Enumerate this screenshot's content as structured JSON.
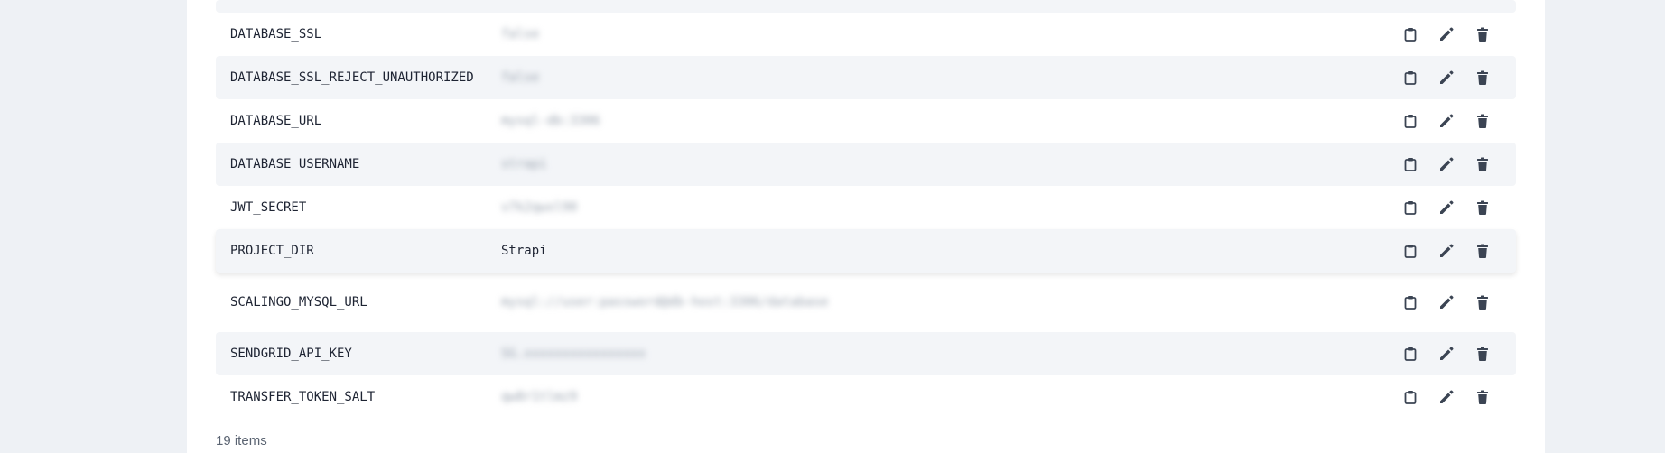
{
  "variables": [
    {
      "name": "DATABASE_SSL",
      "value": "false",
      "masked": true
    },
    {
      "name": "DATABASE_SSL_REJECT_UNAUTHORIZED",
      "value": "false",
      "masked": true
    },
    {
      "name": "DATABASE_URL",
      "value": "mysql-db:3306",
      "masked": true
    },
    {
      "name": "DATABASE_USERNAME",
      "value": "strapi",
      "masked": true
    },
    {
      "name": "JWT_SECRET",
      "value": "v7k2qwxl90",
      "masked": true
    },
    {
      "name": "PROJECT_DIR",
      "value": "Strapi",
      "masked": false
    },
    {
      "name": "SCALINGO_MYSQL_URL",
      "value": "mysql://user:password@db-host:3306/database",
      "masked": true
    },
    {
      "name": "SENDGRID_API_KEY",
      "value": "SG.xxxxxxxxxxxxxxxx",
      "masked": true
    },
    {
      "name": "TRANSFER_TOKEN_SALT",
      "value": "qw8r1tlmz9",
      "masked": true
    }
  ],
  "footer": {
    "count_label": "19 items"
  },
  "icons": {
    "copy": "clipboard-icon",
    "edit": "pencil-icon",
    "delete": "trash-icon"
  },
  "colors": {
    "icon": "#3b4453",
    "row_alt": "#f3f5f8",
    "background": "#eef1f5"
  }
}
